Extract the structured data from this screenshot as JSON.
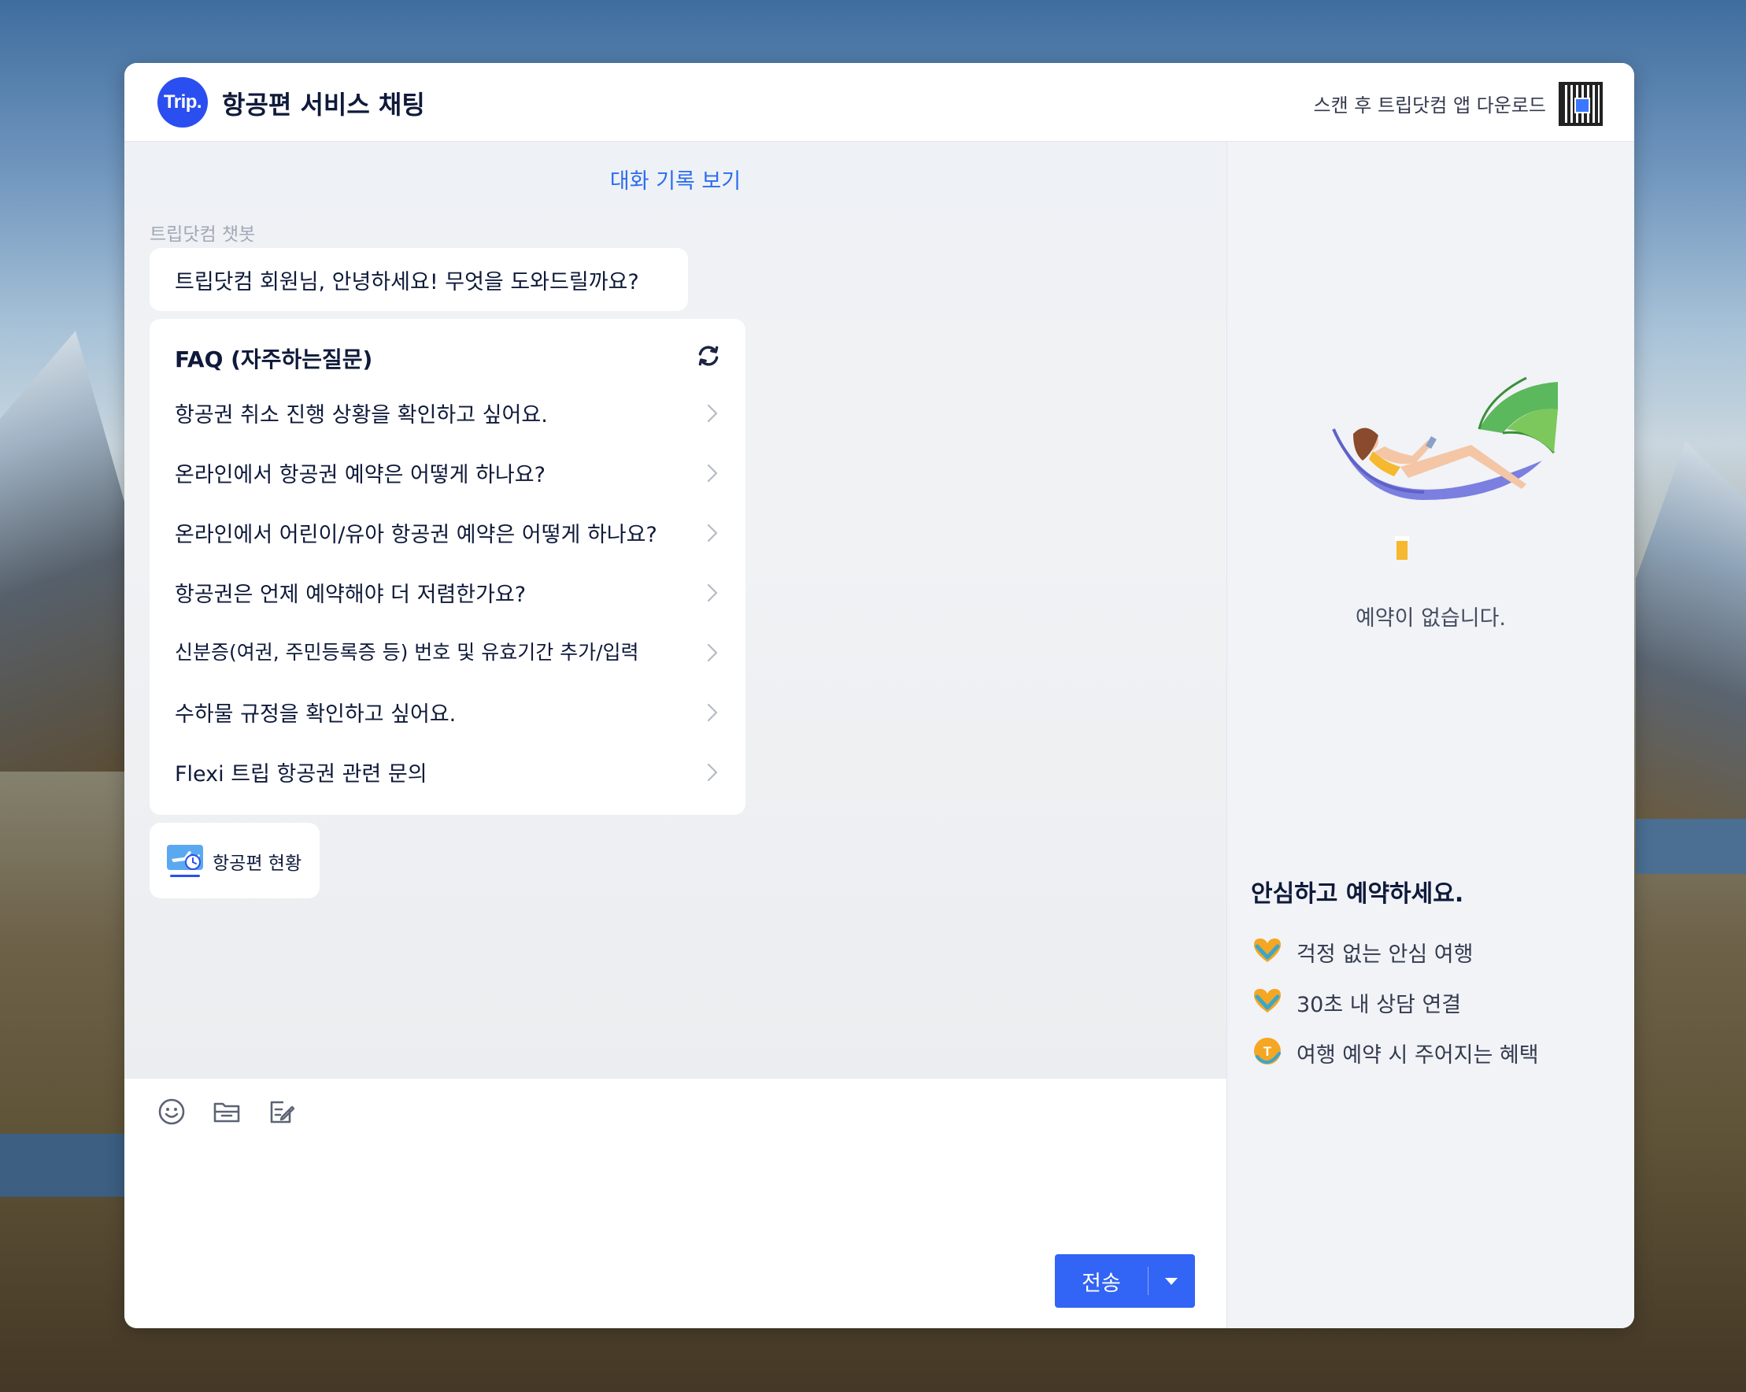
{
  "header": {
    "logo_text": "Trip.",
    "title": "항공편 서비스 채팅",
    "scan_text": "스캔 후 트립닷컴 앱 다운로드"
  },
  "chat": {
    "history_link": "대화 기록 보기",
    "bot_name": "트립닷컴 챗봇",
    "greeting": "트립닷컴 회원님, 안녕하세요! 무엇을 도와드릴까요?",
    "faq": {
      "title": "FAQ (자주하는질문)",
      "items": [
        "항공권 취소 진행 상황을 확인하고 싶어요.",
        "온라인에서 항공권 예약은 어떻게 하나요?",
        "온라인에서 어린이/유아 항공권 예약은 어떻게 하나요?",
        "항공권은 언제 예약해야 더 저렴한가요?",
        "신분증(여권, 주민등록증 등) 번호 및 유효기간 추가/입력",
        "수하물 규정을 확인하고 싶어요.",
        "Flexi 트립 항공권 관련 문의"
      ]
    },
    "flight_status_label": "항공편 현황"
  },
  "composer": {
    "send_label": "전송",
    "tools": [
      "emoji-icon",
      "folder-icon",
      "edit-note-icon"
    ]
  },
  "side": {
    "empty_text": "예약이 없습니다.",
    "safe_title": "안심하고 예약하세요.",
    "benefits": [
      "걱정 없는 안심 여행",
      "30초 내 상담 연결",
      "여행 예약 시 주어지는 혜택"
    ]
  },
  "colors": {
    "brand_blue": "#2b4ef0",
    "link_blue": "#2b6cf0",
    "send_button": "#3264f5",
    "text_dark": "#0f1a3a"
  }
}
